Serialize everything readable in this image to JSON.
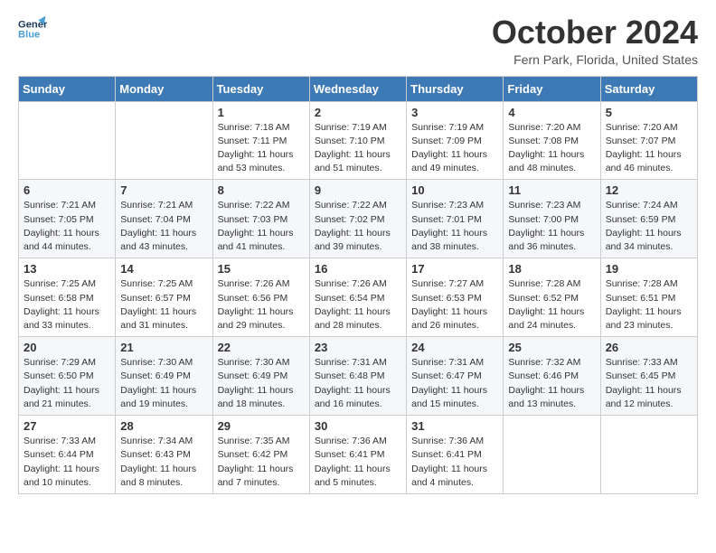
{
  "header": {
    "logo_line1": "General",
    "logo_line2": "Blue",
    "month": "October 2024",
    "location": "Fern Park, Florida, United States"
  },
  "days_of_week": [
    "Sunday",
    "Monday",
    "Tuesday",
    "Wednesday",
    "Thursday",
    "Friday",
    "Saturday"
  ],
  "weeks": [
    [
      {
        "day": "",
        "content": ""
      },
      {
        "day": "",
        "content": ""
      },
      {
        "day": "1",
        "content": "Sunrise: 7:18 AM\nSunset: 7:11 PM\nDaylight: 11 hours and 53 minutes."
      },
      {
        "day": "2",
        "content": "Sunrise: 7:19 AM\nSunset: 7:10 PM\nDaylight: 11 hours and 51 minutes."
      },
      {
        "day": "3",
        "content": "Sunrise: 7:19 AM\nSunset: 7:09 PM\nDaylight: 11 hours and 49 minutes."
      },
      {
        "day": "4",
        "content": "Sunrise: 7:20 AM\nSunset: 7:08 PM\nDaylight: 11 hours and 48 minutes."
      },
      {
        "day": "5",
        "content": "Sunrise: 7:20 AM\nSunset: 7:07 PM\nDaylight: 11 hours and 46 minutes."
      }
    ],
    [
      {
        "day": "6",
        "content": "Sunrise: 7:21 AM\nSunset: 7:05 PM\nDaylight: 11 hours and 44 minutes."
      },
      {
        "day": "7",
        "content": "Sunrise: 7:21 AM\nSunset: 7:04 PM\nDaylight: 11 hours and 43 minutes."
      },
      {
        "day": "8",
        "content": "Sunrise: 7:22 AM\nSunset: 7:03 PM\nDaylight: 11 hours and 41 minutes."
      },
      {
        "day": "9",
        "content": "Sunrise: 7:22 AM\nSunset: 7:02 PM\nDaylight: 11 hours and 39 minutes."
      },
      {
        "day": "10",
        "content": "Sunrise: 7:23 AM\nSunset: 7:01 PM\nDaylight: 11 hours and 38 minutes."
      },
      {
        "day": "11",
        "content": "Sunrise: 7:23 AM\nSunset: 7:00 PM\nDaylight: 11 hours and 36 minutes."
      },
      {
        "day": "12",
        "content": "Sunrise: 7:24 AM\nSunset: 6:59 PM\nDaylight: 11 hours and 34 minutes."
      }
    ],
    [
      {
        "day": "13",
        "content": "Sunrise: 7:25 AM\nSunset: 6:58 PM\nDaylight: 11 hours and 33 minutes."
      },
      {
        "day": "14",
        "content": "Sunrise: 7:25 AM\nSunset: 6:57 PM\nDaylight: 11 hours and 31 minutes."
      },
      {
        "day": "15",
        "content": "Sunrise: 7:26 AM\nSunset: 6:56 PM\nDaylight: 11 hours and 29 minutes."
      },
      {
        "day": "16",
        "content": "Sunrise: 7:26 AM\nSunset: 6:54 PM\nDaylight: 11 hours and 28 minutes."
      },
      {
        "day": "17",
        "content": "Sunrise: 7:27 AM\nSunset: 6:53 PM\nDaylight: 11 hours and 26 minutes."
      },
      {
        "day": "18",
        "content": "Sunrise: 7:28 AM\nSunset: 6:52 PM\nDaylight: 11 hours and 24 minutes."
      },
      {
        "day": "19",
        "content": "Sunrise: 7:28 AM\nSunset: 6:51 PM\nDaylight: 11 hours and 23 minutes."
      }
    ],
    [
      {
        "day": "20",
        "content": "Sunrise: 7:29 AM\nSunset: 6:50 PM\nDaylight: 11 hours and 21 minutes."
      },
      {
        "day": "21",
        "content": "Sunrise: 7:30 AM\nSunset: 6:49 PM\nDaylight: 11 hours and 19 minutes."
      },
      {
        "day": "22",
        "content": "Sunrise: 7:30 AM\nSunset: 6:49 PM\nDaylight: 11 hours and 18 minutes."
      },
      {
        "day": "23",
        "content": "Sunrise: 7:31 AM\nSunset: 6:48 PM\nDaylight: 11 hours and 16 minutes."
      },
      {
        "day": "24",
        "content": "Sunrise: 7:31 AM\nSunset: 6:47 PM\nDaylight: 11 hours and 15 minutes."
      },
      {
        "day": "25",
        "content": "Sunrise: 7:32 AM\nSunset: 6:46 PM\nDaylight: 11 hours and 13 minutes."
      },
      {
        "day": "26",
        "content": "Sunrise: 7:33 AM\nSunset: 6:45 PM\nDaylight: 11 hours and 12 minutes."
      }
    ],
    [
      {
        "day": "27",
        "content": "Sunrise: 7:33 AM\nSunset: 6:44 PM\nDaylight: 11 hours and 10 minutes."
      },
      {
        "day": "28",
        "content": "Sunrise: 7:34 AM\nSunset: 6:43 PM\nDaylight: 11 hours and 8 minutes."
      },
      {
        "day": "29",
        "content": "Sunrise: 7:35 AM\nSunset: 6:42 PM\nDaylight: 11 hours and 7 minutes."
      },
      {
        "day": "30",
        "content": "Sunrise: 7:36 AM\nSunset: 6:41 PM\nDaylight: 11 hours and 5 minutes."
      },
      {
        "day": "31",
        "content": "Sunrise: 7:36 AM\nSunset: 6:41 PM\nDaylight: 11 hours and 4 minutes."
      },
      {
        "day": "",
        "content": ""
      },
      {
        "day": "",
        "content": ""
      }
    ]
  ]
}
